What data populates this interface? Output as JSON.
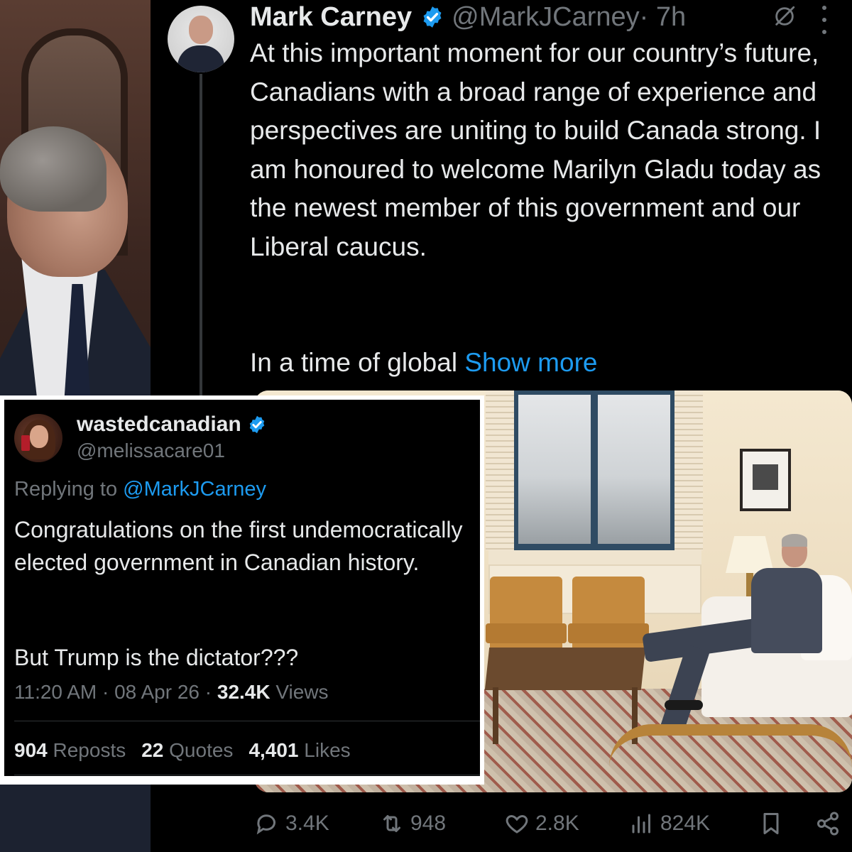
{
  "main_tweet": {
    "author_name": "Mark Carney",
    "author_handle": "@MarkJCarney",
    "time_ago": "· 7h",
    "text_paragraph_1": "At this important moment for our country’s future, Canadians with a broad range of experience and perspectives are uniting to build Canada strong. I am honoured to welcome Marilyn Gladu today as the newest member of this government and our Liberal caucus.",
    "text_paragraph_2": "In a time of global",
    "show_more_label": "Show more",
    "actions": {
      "replies": "3.4K",
      "reposts": "948",
      "likes": "2.8K",
      "views": "824K"
    }
  },
  "reply_tweet": {
    "author_name": "wastedcanadian",
    "author_handle": "@melissacare01",
    "replying_prefix": "Replying to",
    "replying_to": "@MarkJCarney",
    "text_paragraph_1": "Congratulations on the first undemocratically elected government in Canadian history.",
    "text_paragraph_2": "But Trump is the dictator???",
    "meta_time": "11:20 AM · 08 Apr 26 · ",
    "meta_views_count": "32.4K",
    "meta_views_label": " Views",
    "stats": {
      "reposts_count": "904",
      "reposts_label": "Reposts",
      "quotes_count": "22",
      "quotes_label": "Quotes",
      "likes_count": "4,401",
      "likes_label": "Likes"
    }
  },
  "icons": {
    "verified": "verified-badge-icon",
    "grok": "grok-icon",
    "more": "more-icon",
    "reply": "reply-icon",
    "repost": "repost-icon",
    "like": "heart-icon",
    "views": "analytics-icon",
    "bookmark": "bookmark-icon",
    "share": "share-icon"
  },
  "colors": {
    "background": "#000000",
    "text_primary": "#e7e9ea",
    "text_secondary": "#71767b",
    "accent_blue": "#1d9bf0",
    "card_border": "#ffffff"
  }
}
